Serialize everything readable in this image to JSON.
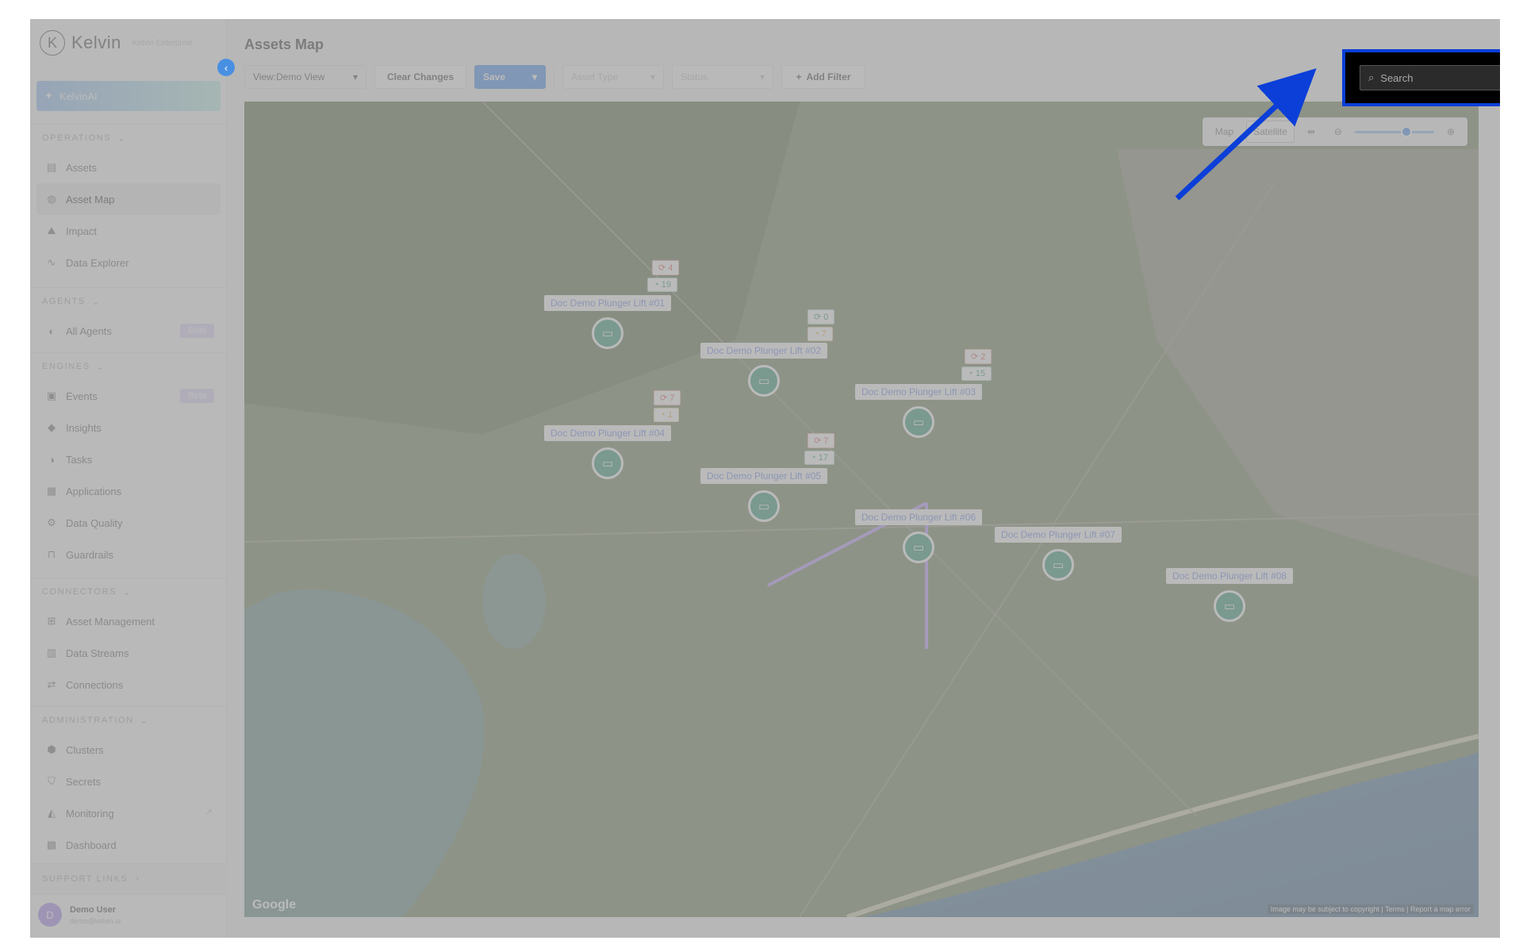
{
  "sidebar": {
    "logo": {
      "name": "Kelvin",
      "subtitle": "Kelvin Enterprise"
    },
    "kelvinai_label": "KelvinAI",
    "sections": {
      "operations": {
        "title": "OPERATIONS",
        "items": [
          "Assets",
          "Asset Map",
          "Impact",
          "Data Explorer"
        ]
      },
      "agents": {
        "title": "AGENTS",
        "items": [
          "All Agents"
        ]
      },
      "engines": {
        "title": "ENGINES",
        "items": [
          "Events",
          "Insights",
          "Tasks",
          "Applications",
          "Data Quality",
          "Guardrails"
        ]
      },
      "connectors": {
        "title": "CONNECTORS",
        "items": [
          "Asset Management",
          "Data Streams",
          "Connections"
        ]
      },
      "administration": {
        "title": "ADMINISTRATION",
        "items": [
          "Clusters",
          "Secrets",
          "Monitoring",
          "Dashboard"
        ]
      }
    },
    "beta_label": "Beta",
    "support_links": "SUPPORT LINKS",
    "user": {
      "initial": "D",
      "name": "Demo User",
      "email": "demo@kelvin.ai"
    }
  },
  "header": {
    "title": "Assets Map"
  },
  "toolbar": {
    "view_label": "View:",
    "view_value": "Demo View",
    "clear_label": "Clear Changes",
    "save_label": "Save",
    "asset_type_placeholder": "Asset Type",
    "status_placeholder": "Status",
    "add_filter_label": "Add Filter"
  },
  "map": {
    "controls": {
      "map": "Map",
      "satellite": "Satellite"
    },
    "google": "Google",
    "copyright": "Image may be subject to copyright | Terms | Report a map error",
    "assets": [
      {
        "label": "Doc Demo Plunger Lift #01",
        "stat_top": "4",
        "stat_bottom": "19",
        "bottom_kind": "green"
      },
      {
        "label": "Doc Demo Plunger Lift #02",
        "stat_top": "0",
        "stat_bottom": "7",
        "bottom_kind": "amber"
      },
      {
        "label": "Doc Demo Plunger Lift #03",
        "stat_top": "2",
        "stat_bottom": "15",
        "bottom_kind": "green"
      },
      {
        "label": "Doc Demo Plunger Lift #04",
        "stat_top": "7",
        "stat_bottom": "1",
        "bottom_kind": "amber"
      },
      {
        "label": "Doc Demo Plunger Lift #05",
        "stat_top": "7",
        "stat_bottom": "17",
        "bottom_kind": "green"
      },
      {
        "label": "Doc Demo Plunger Lift #06"
      },
      {
        "label": "Doc Demo Plunger Lift #07"
      },
      {
        "label": "Doc Demo Plunger Lift #08"
      }
    ]
  },
  "search": {
    "placeholder": "Search"
  },
  "colors": {
    "accent": "#2f80ed",
    "highlight": "#0b3fd8",
    "pin": "#1c8a64",
    "beta": "#d9d0fb"
  }
}
